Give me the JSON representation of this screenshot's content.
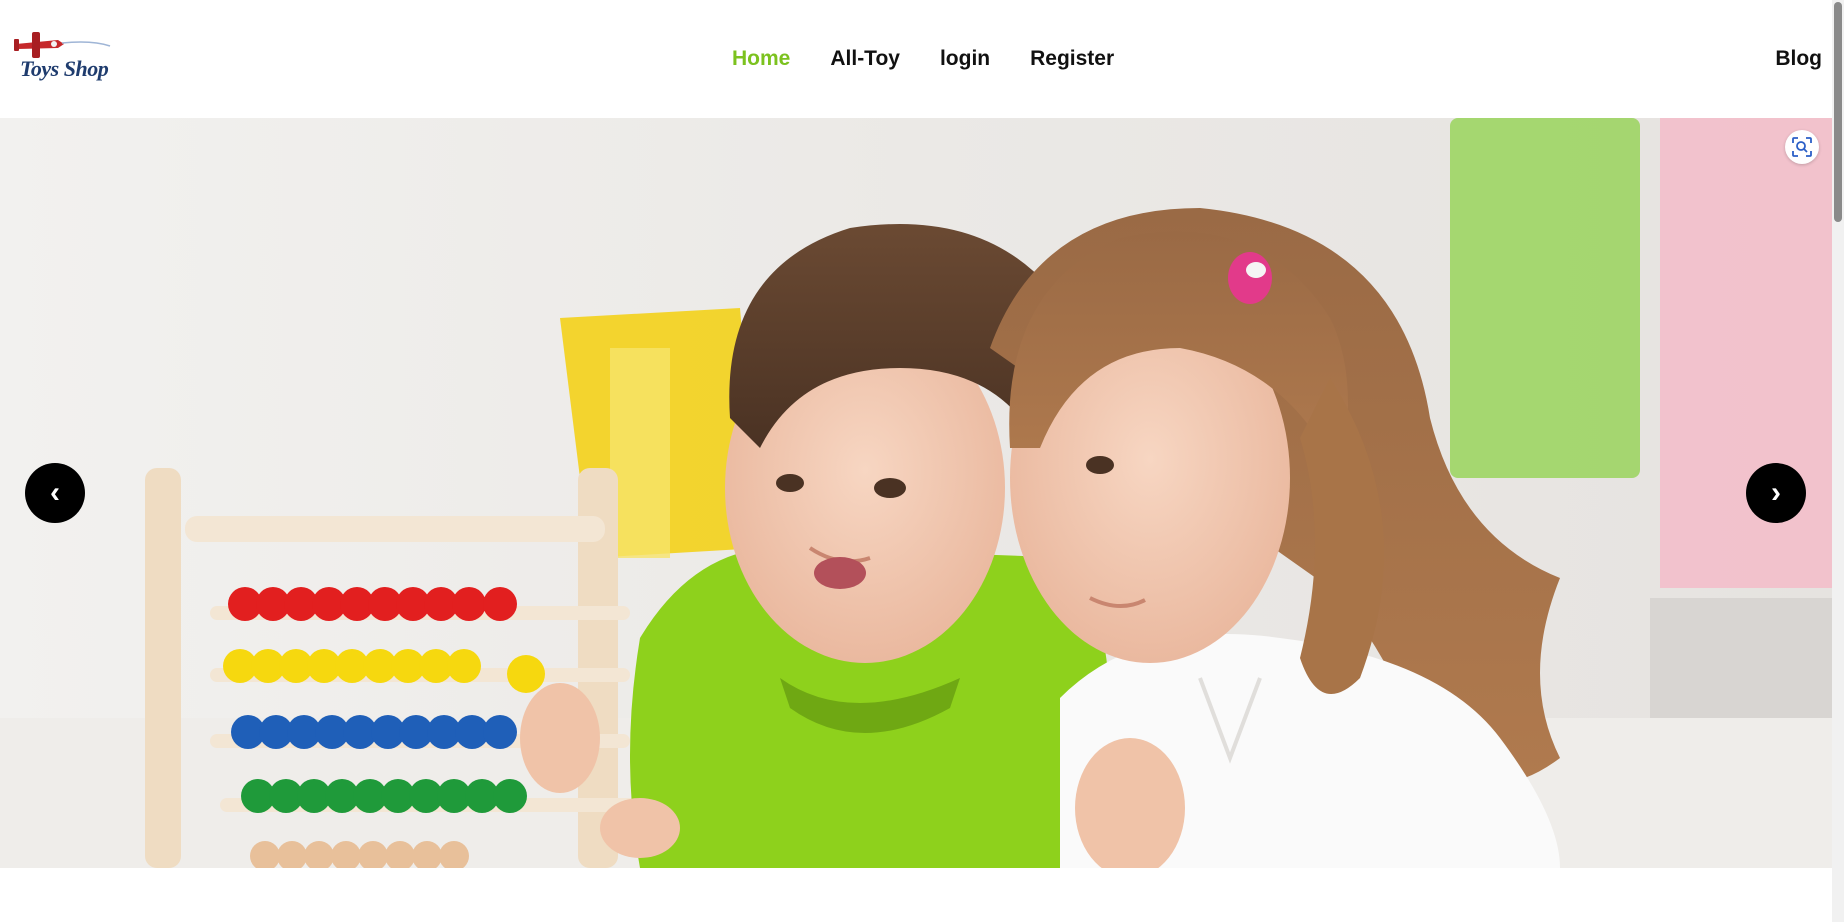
{
  "brand": {
    "logo_text": "Toys Shop"
  },
  "nav": {
    "links": [
      {
        "label": "Home",
        "active": true
      },
      {
        "label": "All-Toy",
        "active": false
      },
      {
        "label": "login",
        "active": false
      },
      {
        "label": "Register",
        "active": false
      }
    ],
    "blog_label": "Blog"
  },
  "hero": {
    "prev_label": "‹",
    "next_label": "›",
    "image_subject": "two children playing with a wooden abacus",
    "lens_icon": "visual-search-icon"
  },
  "colors": {
    "accent": "#7cc21f",
    "nav_text": "#111111",
    "button_bg": "#000000",
    "logo_text": "#1f3c6e"
  }
}
